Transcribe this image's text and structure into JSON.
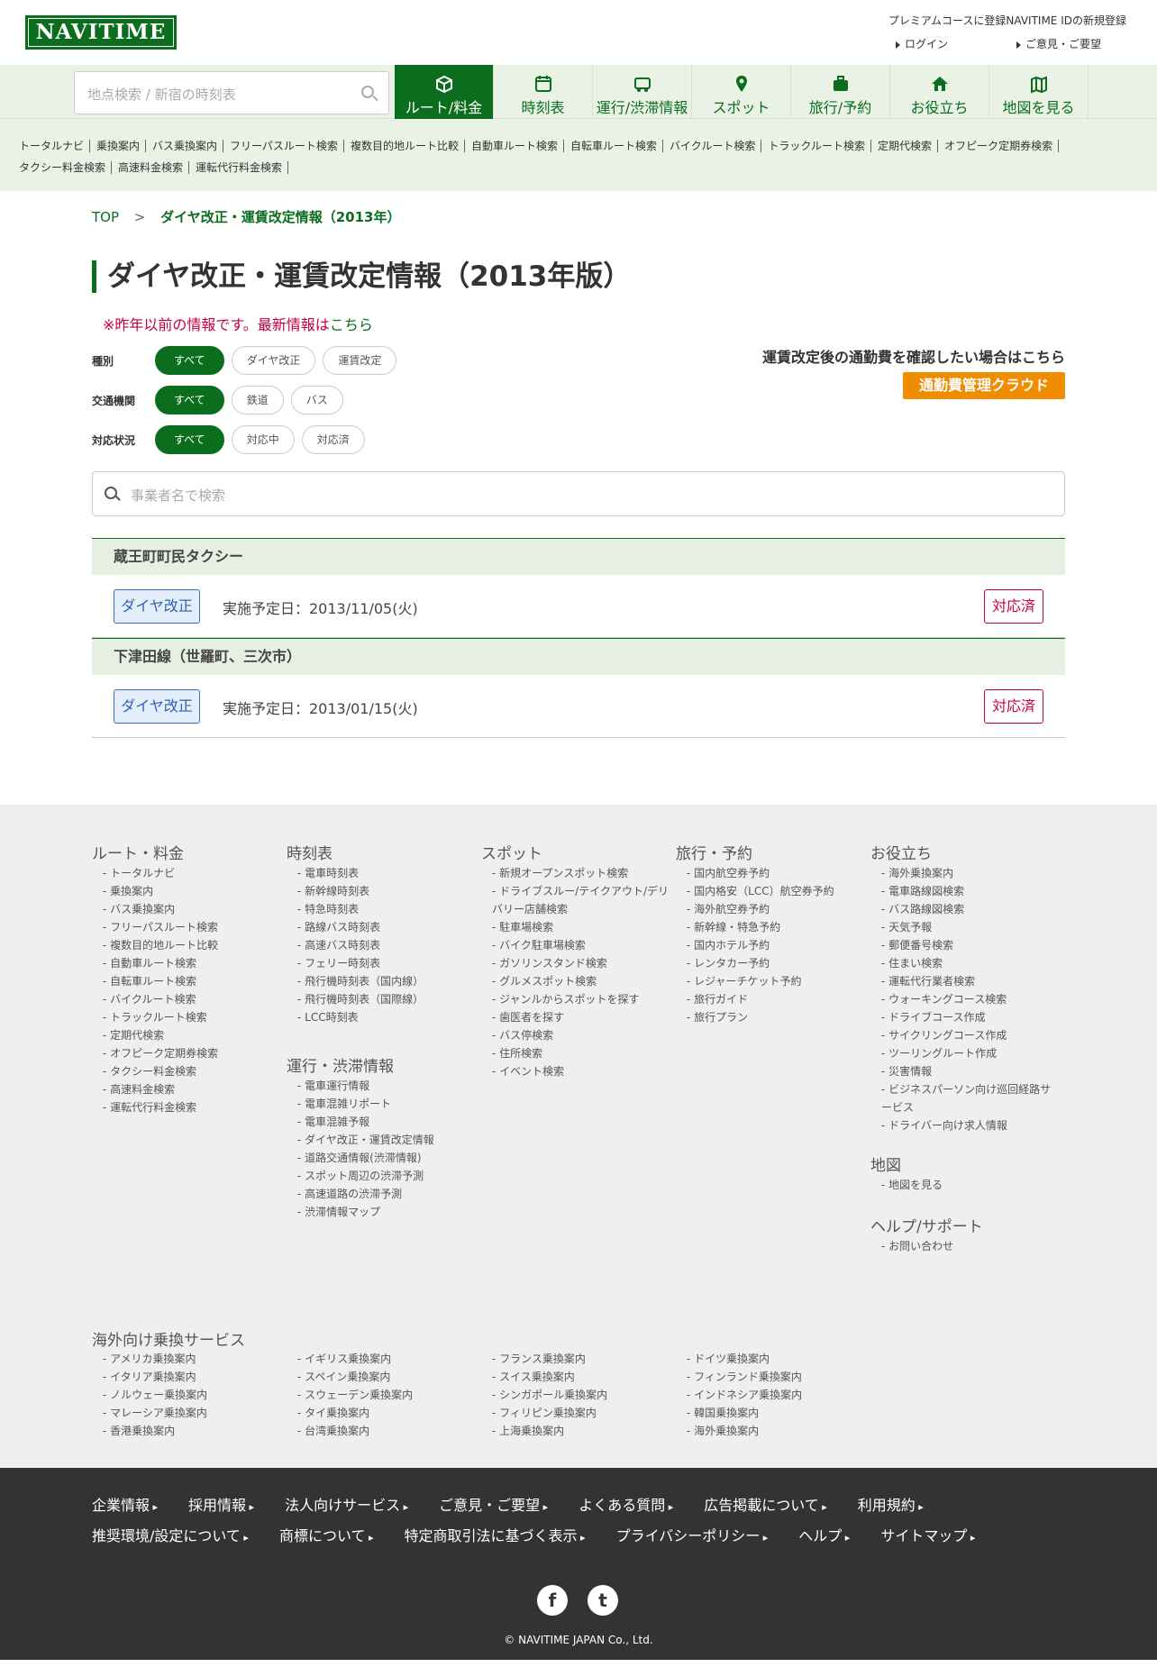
{
  "header": {
    "logo": "NAVITIME",
    "premium_link": "プレミアムコースに登録NAVITIME IDの新規登録",
    "login": "ログイン",
    "feedback": "ご意見・ご要望"
  },
  "nav": {
    "search_placeholder": "地点検索 / 新宿の時刻表",
    "items": [
      {
        "label": "ルート/料金",
        "icon": "route-box-icon"
      },
      {
        "label": "時刻表",
        "icon": "timetable-icon"
      },
      {
        "label": "運行/渋滞情報",
        "icon": "traffic-icon"
      },
      {
        "label": "スポット",
        "icon": "pin-icon"
      },
      {
        "label": "旅行/予約",
        "icon": "suitcase-icon"
      },
      {
        "label": "お役立ち",
        "icon": "house-icon"
      },
      {
        "label": "地図を見る",
        "icon": "map-icon"
      }
    ]
  },
  "subnav": [
    "トータルナビ",
    "乗換案内",
    "バス乗換案内",
    "フリーパスルート検索",
    "複数目的地ルート比較",
    "自動車ルート検索",
    "自転車ルート検索",
    "バイクルート検索",
    "トラックルート検索",
    "定期代検索",
    "オフピーク定期券検索",
    "タクシー料金検索",
    "高速料金検索",
    "運転代行料金検索"
  ],
  "breadcrumb": {
    "top": "TOP",
    "sep": ">",
    "current": "ダイヤ改正・運賃改定情報（2013年）"
  },
  "title": "ダイヤ改正・運賃改定情報（2013年版）",
  "notice": {
    "text": "※昨年以前の情報です。最新情報は",
    "link": "こちら"
  },
  "filters": [
    {
      "label": "種別",
      "options": [
        "すべて",
        "ダイヤ改正",
        "運賃改定"
      ]
    },
    {
      "label": "交通機関",
      "options": [
        "すべて",
        "鉄道",
        "バス"
      ]
    },
    {
      "label": "対応状況",
      "options": [
        "すべて",
        "対応中",
        "対応済"
      ]
    }
  ],
  "commute": {
    "text": "運賃改定後の通勤費を確認したい場合はこちら",
    "button": "通勤費管理クラウド"
  },
  "biz_search_placeholder": "事業者名で検索",
  "results": [
    {
      "name": "蔵王町町民タクシー",
      "tag": "ダイヤ改正",
      "date": "実施予定日：2013/11/05(火)",
      "status": "対応済"
    },
    {
      "name": "下津田線（世羅町、三次市）",
      "tag": "ダイヤ改正",
      "date": "実施予定日：2013/01/15(火)",
      "status": "対応済"
    }
  ],
  "footer_cols": {
    "route": {
      "title": "ルート・料金",
      "items": [
        "トータルナビ",
        "乗換案内",
        "バス乗換案内",
        "フリーパスルート検索",
        "複数目的地ルート比較",
        "自動車ルート検索",
        "自転車ルート検索",
        "バイクルート検索",
        "トラックルート検索",
        "定期代検索",
        "オフピーク定期券検索",
        "タクシー料金検索",
        "高速料金検索",
        "運転代行料金検索"
      ]
    },
    "timetable": {
      "title": "時刻表",
      "items": [
        "電車時刻表",
        "新幹線時刻表",
        "特急時刻表",
        "路線バス時刻表",
        "高速バス時刻表",
        "フェリー時刻表",
        "飛行機時刻表（国内線）",
        "飛行機時刻表（国際線）",
        "LCC時刻表"
      ]
    },
    "operation": {
      "title": "運行・渋滞情報",
      "items": [
        "電車運行情報",
        "電車混雑リポート",
        "電車混雑予報",
        "ダイヤ改正・運賃改定情報",
        "道路交通情報(渋滞情報)",
        "スポット周辺の渋滞予測",
        "高速道路の渋滞予測",
        "渋滞情報マップ"
      ]
    },
    "spot": {
      "title": "スポット",
      "items": [
        "新規オープンスポット検索",
        "ドライブスルー/テイクアウト/デリバリー店舗検索",
        "駐車場検索",
        "バイク駐車場検索",
        "ガソリンスタンド検索",
        "グルメスポット検索",
        "ジャンルからスポットを探す",
        "歯医者を探す",
        "バス停検索",
        "住所検索",
        "イベント検索"
      ]
    },
    "travel": {
      "title": "旅行・予約",
      "items": [
        "国内航空券予約",
        "国内格安（LCC）航空券予約",
        "海外航空券予約",
        "新幹線・特急予約",
        "国内ホテル予約",
        "レンタカー予約",
        "レジャーチケット予約",
        "旅行ガイド",
        "旅行プラン"
      ]
    },
    "useful": {
      "title": "お役立ち",
      "items": [
        "海外乗換案内",
        "電車路線図検索",
        "バス路線図検索",
        "天気予報",
        "郵便番号検索",
        "住まい検索",
        "運転代行業者検索",
        "ウォーキングコース検索",
        "ドライブコース作成",
        "サイクリングコース作成",
        "ツーリングルート作成",
        "災害情報",
        "ビジネスパーソン向け巡回経路サービス",
        "ドライバー向け求人情報"
      ]
    },
    "map": {
      "title": "地図",
      "items": [
        "地図を見る"
      ]
    },
    "help": {
      "title": "ヘルプ/サポート",
      "items": [
        "お問い合わせ"
      ]
    }
  },
  "overseas": {
    "title": "海外向け乗換サービス",
    "cols": [
      [
        "アメリカ乗換案内",
        "イタリア乗換案内",
        "ノルウェー乗換案内",
        "マレーシア乗換案内",
        "香港乗換案内"
      ],
      [
        "イギリス乗換案内",
        "スペイン乗換案内",
        "スウェーデン乗換案内",
        "タイ乗換案内",
        "台湾乗換案内"
      ],
      [
        "フランス乗換案内",
        "スイス乗換案内",
        "シンガポール乗換案内",
        "フィリピン乗換案内",
        "上海乗換案内"
      ],
      [
        "ドイツ乗換案内",
        "フィンランド乗換案内",
        "インドネシア乗換案内",
        "韓国乗換案内",
        "海外乗換案内"
      ]
    ]
  },
  "footer_dark": {
    "row1": [
      "企業情報",
      "採用情報",
      "法人向けサービス",
      "ご意見・ご要望",
      "よくある質問",
      "広告掲載について",
      "利用規約"
    ],
    "row2": [
      "推奨環境/設定について",
      "商標について",
      "特定商取引法に基づく表示",
      "プライバシーポリシー",
      "ヘルプ",
      "サイトマップ"
    ],
    "social": [
      "f",
      "t"
    ],
    "copyright": "© NAVITIME JAPAN Co., Ltd."
  }
}
